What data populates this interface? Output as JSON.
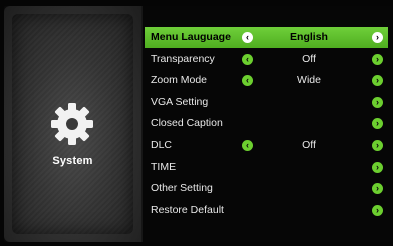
{
  "category": {
    "label": "System",
    "icon": "gear-icon"
  },
  "menu": {
    "items": [
      {
        "label": "Menu Lauguage",
        "value": "English",
        "left_arrow": "chevron-left-icon",
        "right_arrow": "chevron-right-icon",
        "selected": true
      },
      {
        "label": "Transparency",
        "value": "Off",
        "left_arrow": "chevron-left-icon",
        "right_arrow": "chevron-right-icon",
        "selected": false
      },
      {
        "label": "Zoom Mode",
        "value": "Wide",
        "left_arrow": "chevron-left-icon",
        "right_arrow": "chevron-right-icon",
        "selected": false
      },
      {
        "label": "VGA Setting",
        "value": "",
        "right_arrow": "chevron-right-icon",
        "selected": false
      },
      {
        "label": "Closed Caption",
        "value": "",
        "right_arrow": "chevron-right-icon",
        "selected": false
      },
      {
        "label": "DLC",
        "value": "Off",
        "left_arrow": "chevron-left-icon",
        "right_arrow": "chevron-right-icon",
        "selected": false
      },
      {
        "label": "TIME",
        "value": "",
        "right_arrow": "chevron-right-icon",
        "selected": false
      },
      {
        "label": "Other Setting",
        "value": "",
        "right_arrow": "chevron-right-icon",
        "selected": false
      },
      {
        "label": "Restore Default",
        "value": "",
        "right_arrow": "chevron-right-icon",
        "selected": false
      }
    ]
  },
  "colors": {
    "accent": "#5cbf2a",
    "background": "#060606",
    "text": "#e8e8e8"
  }
}
